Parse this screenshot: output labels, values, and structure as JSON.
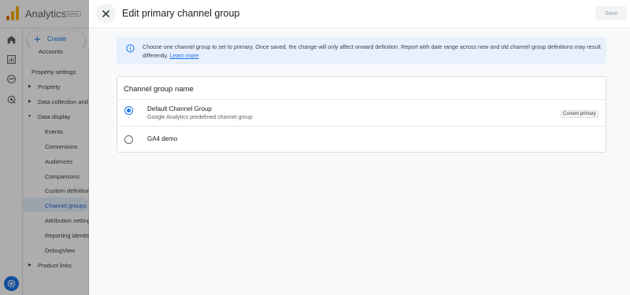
{
  "app": {
    "title": "Analytics",
    "badge": "ALPHA",
    "create_label": "Create",
    "accent": "#1a73e8"
  },
  "rail_icons": [
    "home-icon",
    "reports-icon",
    "explore-icon",
    "advertising-icon"
  ],
  "admin_nav": {
    "partial_item": "Accounts",
    "section_label": "Property settings",
    "items": [
      {
        "label": "Property",
        "expandable": true
      },
      {
        "label": "Data collection and",
        "expandable": true
      },
      {
        "label": "Data display",
        "expandable": true,
        "expanded": true
      },
      {
        "label": "Events"
      },
      {
        "label": "Conversions"
      },
      {
        "label": "Audiences"
      },
      {
        "label": "Comparisons"
      },
      {
        "label": "Custom definitions"
      },
      {
        "label": "Channel groups",
        "selected": true
      },
      {
        "label": "Attribution settings"
      },
      {
        "label": "Reporting identity"
      },
      {
        "label": "DebugView"
      },
      {
        "label": "Product links",
        "expandable": true
      }
    ]
  },
  "dialog": {
    "title": "Edit primary channel group",
    "save_label": "Save",
    "info_text": "Choose one channel group to set to primary. Once saved, the change will only affect onward definition. Report with date range across new and old channel group definitions may result differently.",
    "info_link": "Learn more",
    "card_title": "Channel group name",
    "options": [
      {
        "name": "Default Channel Group",
        "description": "Google Analytics predefined channel group",
        "badge": "Current primary",
        "selected": true
      },
      {
        "name": "GA4 demo",
        "description": "",
        "badge": "",
        "selected": false
      }
    ]
  }
}
